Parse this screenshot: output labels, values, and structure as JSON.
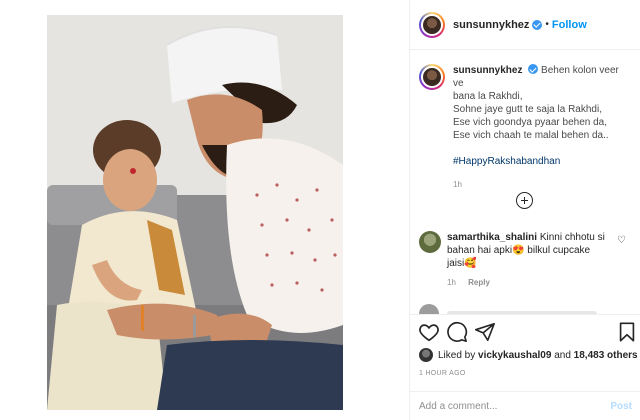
{
  "post": {
    "username": "sunsunnykhez",
    "follow_label": "Follow",
    "separator": "•",
    "caption_lines": [
      "Behen kolon veer ve",
      "bana la Rakhdi,",
      "Sohne jaye gutt te saja la Rakhdi,",
      "Ese vich goondya pyaar behen da,",
      "Ese vich chaah te malal behen da.."
    ],
    "hashtag": "#HappyRakshabandhan",
    "caption_time": "1h"
  },
  "comments": [
    {
      "username": "samarthika_shalini",
      "text": "Kinni chhotu si bahan hai apki😍 bilkul cupcake jaisi🥰",
      "time": "1h",
      "reply_label": "Reply"
    }
  ],
  "likes": {
    "prefix": "Liked by ",
    "user": "vickykaushal09",
    "middle": " and ",
    "others": "18,483 others"
  },
  "timestamp": "1 HOUR AGO",
  "add_comment": {
    "placeholder": "Add a comment...",
    "post_label": "Post"
  },
  "colors": {
    "link_blue": "#0095f6",
    "hashtag_blue": "#00376b",
    "verified_blue": "#3897f0",
    "post_disabled": "#b3dbff"
  },
  "icons": [
    "heart-icon",
    "comment-icon",
    "share-icon",
    "bookmark-icon",
    "add-icon",
    "verified-icon"
  ]
}
